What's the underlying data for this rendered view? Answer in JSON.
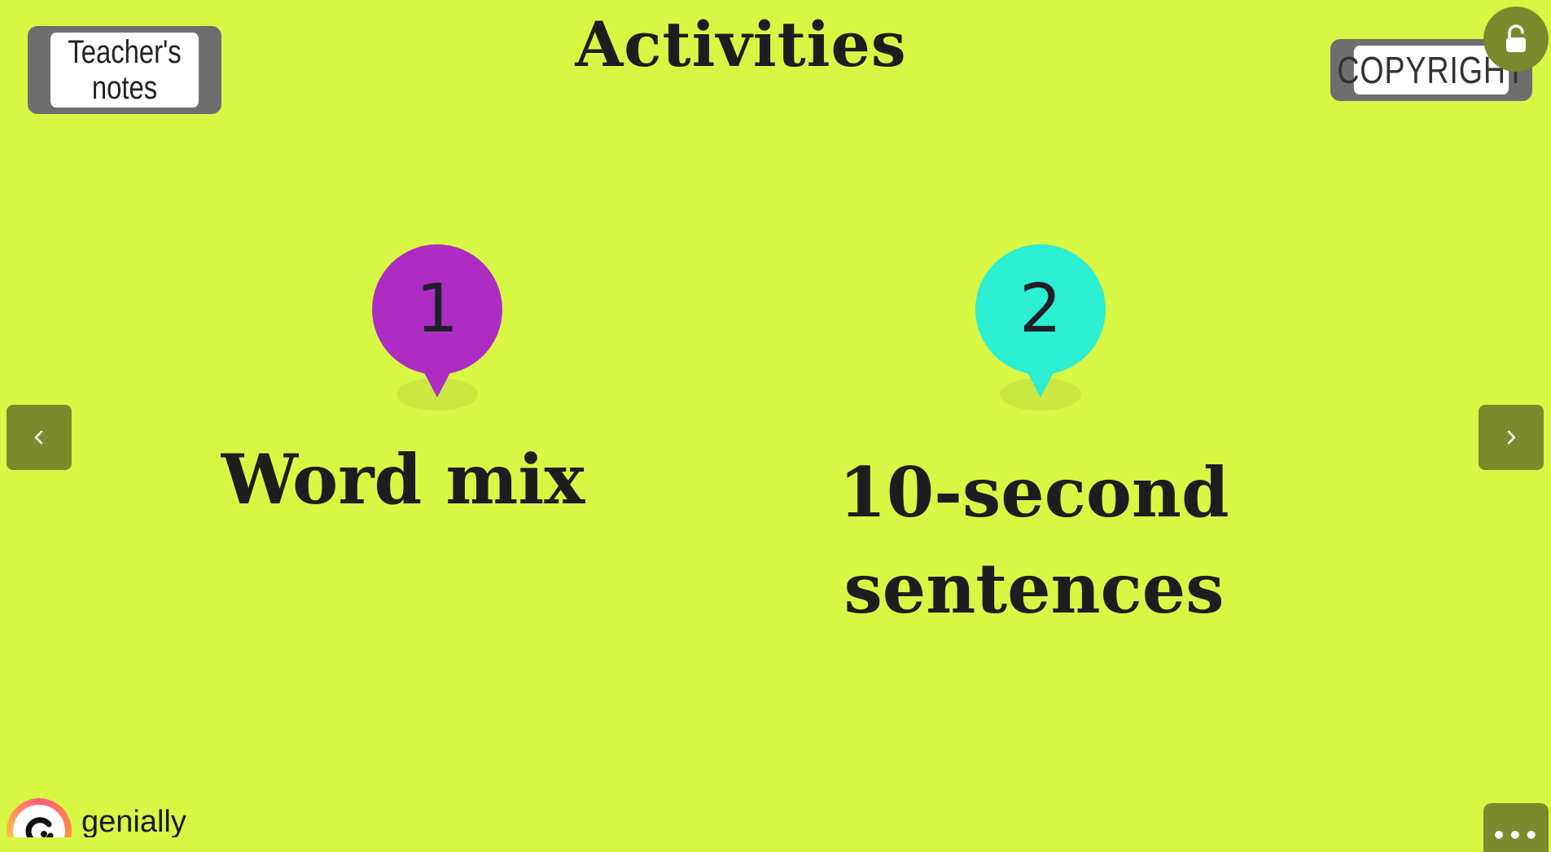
{
  "header": {
    "title": "Activities",
    "teachers_notes": [
      "Teacher's",
      "notes"
    ],
    "copyright_label": "COPYRIGHT"
  },
  "activities": [
    {
      "number": "1",
      "label": "Word mix",
      "color": "#ad2dc4"
    },
    {
      "number": "2",
      "label": "10-second sentences",
      "color": "#2ceed0"
    }
  ],
  "footer": {
    "brand": "genially",
    "more_icon": "more-dots-icon"
  },
  "icons": {
    "prev": "chevron-left-icon",
    "next": "chevron-right-icon",
    "corner": "lock-open-icon"
  },
  "colors": {
    "background": "#d8f744",
    "nav_button": "#7a8a2c",
    "button_frame": "#6e6e6e"
  }
}
